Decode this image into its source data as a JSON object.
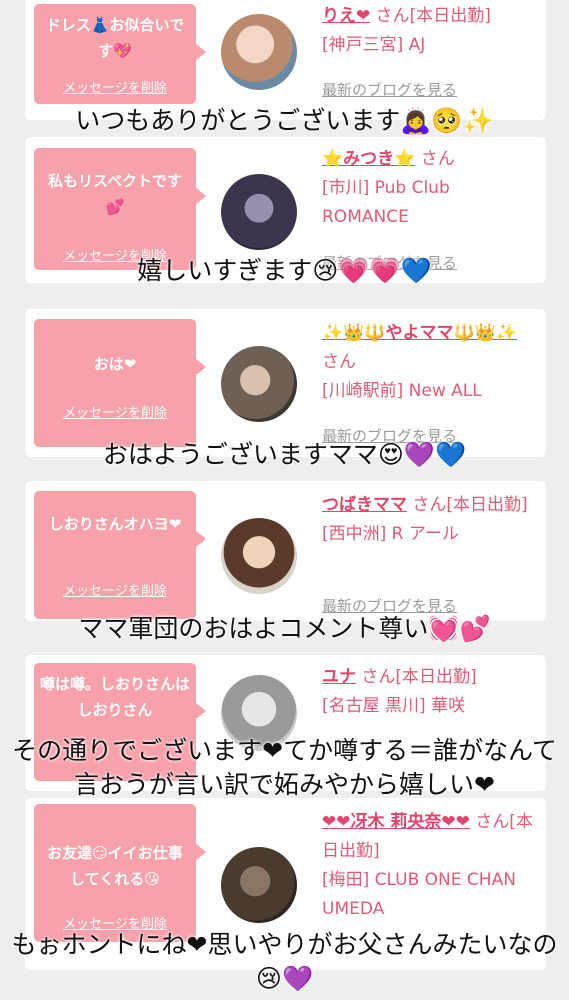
{
  "cards": [
    {
      "message": "ドレス👗お似合いです💖",
      "delete_label": "メッセージを削除",
      "name": "りえ❤",
      "san": "さん[本日出勤]",
      "shop": "[神戸三宮] AJ",
      "blog": "最新のブログを見る",
      "caption": "いつもありがとうございます🙇‍♀️🥺✨",
      "avatar_color": "#cfa792"
    },
    {
      "message": "私もリスペクトです💕",
      "delete_label": "メッセージを削除",
      "name": "⭐みつき⭐",
      "san": "さん",
      "shop": "[市川] Pub Club ROMANCE",
      "blog": "最新のブログを見る",
      "caption": "嬉しいすぎます😢💗💗💙",
      "avatar_color": "#4a3f56"
    },
    {
      "message": "おは❤",
      "delete_label": "メッセージを削除",
      "name": "✨👑🔱やよママ🔱👑✨",
      "san": "さん",
      "shop": "[川崎駅前] New ALL",
      "blog": "最新のブログを見る",
      "caption": "おはようございますママ😍💜💙",
      "avatar_color": "#6d5f55"
    },
    {
      "message": "しおりさんオハヨ❤",
      "delete_label": "メッセージを削除",
      "name": "つばきママ",
      "san": "さん[本日出勤]",
      "shop": "[西中洲] R アール",
      "blog": "最新のブログを見る",
      "caption": "ママ軍団のおはよコメント尊い💓💕",
      "avatar_color": "#c79b7a"
    },
    {
      "message": "噂は噂。しおりさんはしおりさん",
      "delete_label": "",
      "name": "ユナ",
      "san": "さん[本日出勤]",
      "shop": "[名古屋 黒川] 華咲",
      "blog": "",
      "caption": "その通りでございます❤てか噂する＝誰がなんて言おうが言い訳で妬みやから嬉しい❤",
      "avatar_color": "#a8a8a8"
    },
    {
      "message": "お友達😏イイお仕事してくれる😘",
      "delete_label": "メッセージを削除",
      "name": "❤❤冴木 莉央奈❤❤",
      "san": "さん[本日出勤]",
      "shop": "[梅田] CLUB ONE CHAN UMEDA",
      "blog": "",
      "caption": "もぉホントにね❤思いやりがお父さんみたいなの😢💜",
      "avatar_color": "#5b4a3d"
    }
  ]
}
